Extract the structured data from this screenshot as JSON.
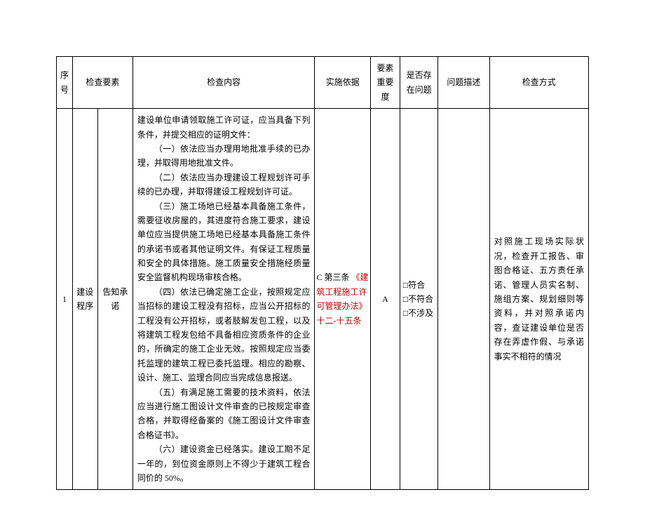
{
  "headers": {
    "seq": "序号",
    "yaosu": "检查要素",
    "content": "检查内容",
    "basis": "实施依据",
    "level": "要素重要度",
    "problem": "是否存在问题",
    "desc": "问题描述",
    "method": "检查方式"
  },
  "row": {
    "seq": "1",
    "yaosu_a": "建设程序",
    "yaosu_b": "告知承诺",
    "content": {
      "p0": "建设单位申请领取施工许可证，应当具备下列条件，并提交相应的证明文件：",
      "p1": "（一）依法应当办理用地批准手续的已办理，并取得用地批准文件。",
      "p2": "（二）依法应当办理建设工程规划许可手续的已办理，并取得建设工程规划许可证。",
      "p3": "（三）施工场地已经基本具备施工条件，需要征收房屋的，其进度符合施工要求，建设单位应当提供施工场地已经基本具备施工条件的承诺书或者其他证明文件。有保证工程质量和安全的具体措施。施工质量安全措施经质量安全监督机构现场审核合格。",
      "p4": "（四）依法已确定施工企业，按照规定应当招标的建设工程没有招标，应当公开招标的工程没有公开招标，或者肢解发包工程，以及将建筑工程发包给不具备相应资质条件的企业的，所确定的施工企业无效。按照规定应当委托监理的建筑工程已委托监理。相应的勘察、设计、施工、监理合同应当完成信息报送。",
      "p5": "（五）有满足施工需要的技术资料，依法应当进行施工图设计文件审查的已按规定审查合格，并取得经备案的《施工图设计文件审查合格证书》。",
      "p6": "（六）建设资金已经落实。建设工期不足一年的，到位资金原则上不得少于建筑工程合同价的 50%。"
    },
    "basis": {
      "text1": "C 第三条",
      "red": "《建筑工程施工许可管理办法》十二-十五条",
      "text2": ""
    },
    "level": "A",
    "problem": {
      "opt1": "□符合",
      "opt2": "□不符合",
      "opt3": "□不涉及"
    },
    "desc": "",
    "method": "对照施工现场实际状况，检查开工报告、审图合格证、五方责任承诺、管理人员实名制、施组方案、规划细则等资料，并对照承诺内容，查证建设单位是否存在弄虚作假、与承诺事实不相符的情况"
  }
}
